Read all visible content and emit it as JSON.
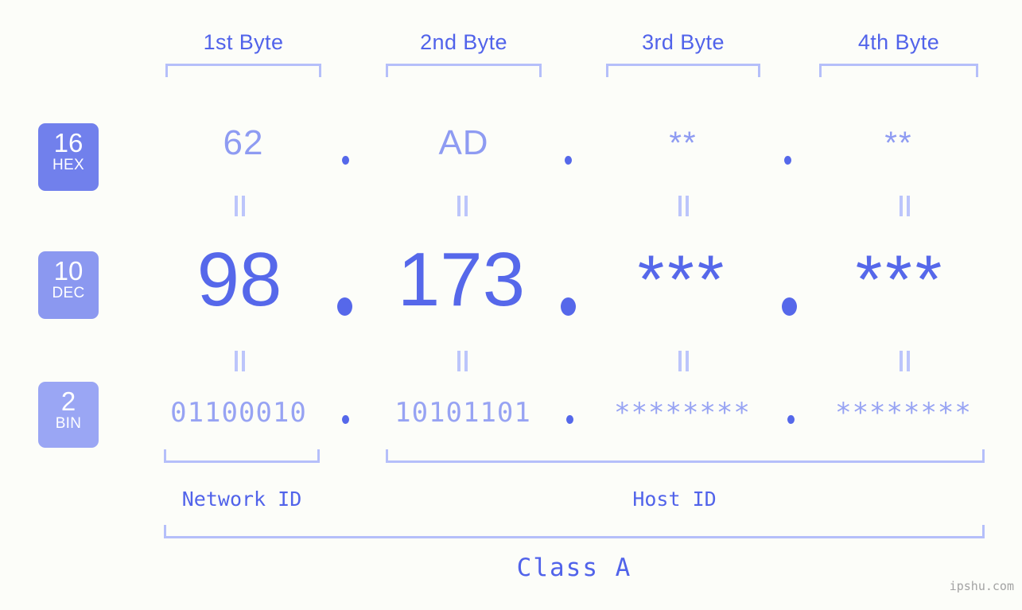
{
  "background_color": "#fcfdf9",
  "accent_colors": {
    "strong_blue": "#5668ea",
    "mid_blue": "#8e9bf2",
    "light_blue": "#b5bffa",
    "badge_hex": "#7180ec",
    "badge_dec": "#8b98f0",
    "badge_bin": "#9aa6f4",
    "watermark_gray": "#a3a3a3"
  },
  "byte_headers": [
    {
      "label": "1st Byte"
    },
    {
      "label": "2nd Byte"
    },
    {
      "label": "3rd Byte"
    },
    {
      "label": "4th Byte"
    }
  ],
  "radix_badges": [
    {
      "number": "16",
      "name": "HEX"
    },
    {
      "number": "10",
      "name": "DEC"
    },
    {
      "number": "2",
      "name": "BIN"
    }
  ],
  "rows": {
    "hex": {
      "values": [
        "62",
        "AD",
        "**",
        "**"
      ],
      "separator": "."
    },
    "dec": {
      "values": [
        "98",
        "173",
        "***",
        "***"
      ],
      "separator": "."
    },
    "bin": {
      "values": [
        "01100010",
        "10101101",
        "********",
        "********"
      ],
      "separator": "."
    }
  },
  "equal_separator": "||",
  "id_labels": [
    {
      "label": "Network ID"
    },
    {
      "label": "Host ID"
    }
  ],
  "class_label": "Class A",
  "watermark": "ipshu.com"
}
